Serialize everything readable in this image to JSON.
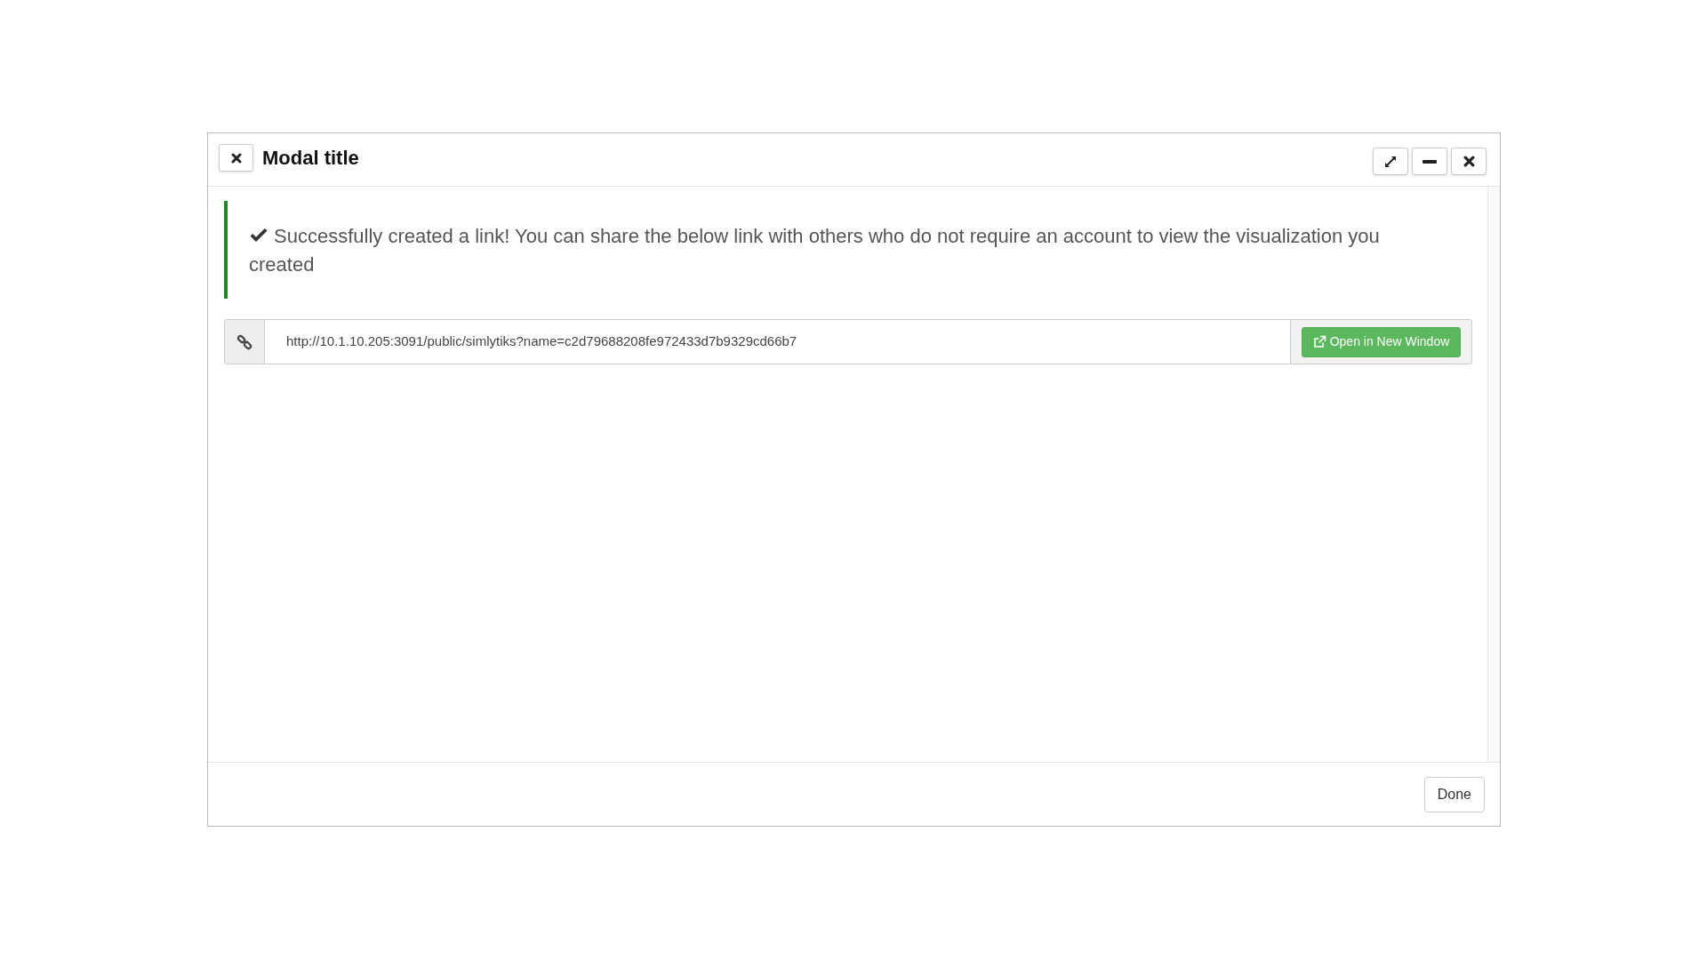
{
  "modal": {
    "title": "Modal title"
  },
  "alert": {
    "message": "Successfully created a link! You can share the below link with others who do not require an account to view the visualization you created"
  },
  "link": {
    "url": "http://10.1.10.205:3091/public/simlytiks?name=c2d79688208fe972433d7b9329cd66b7",
    "button": "Open in New Window"
  },
  "footer": {
    "button": "Done"
  }
}
